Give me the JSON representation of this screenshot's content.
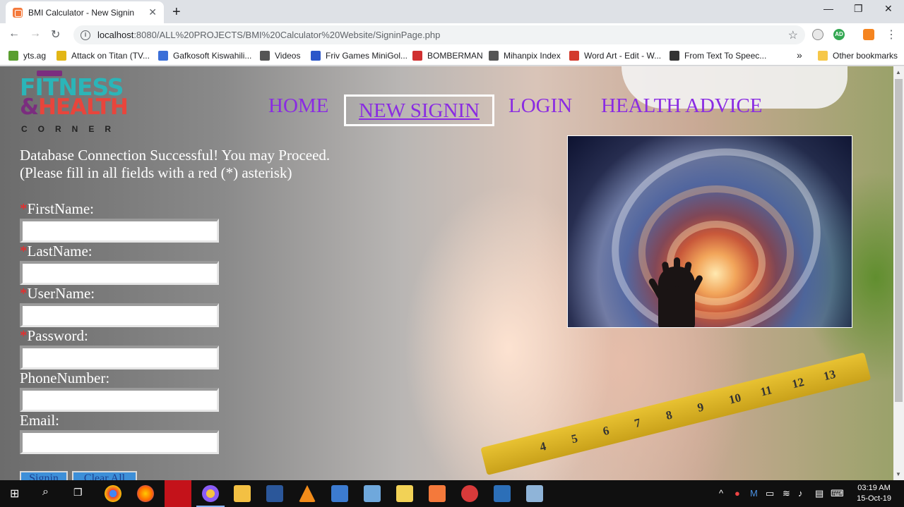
{
  "browser": {
    "tab_title": "BMI Calculator - New Signin",
    "tab_close": "✕",
    "new_tab": "+",
    "minimize": "—",
    "restore": "❐",
    "close": "✕",
    "url_host": "localhost",
    "url_rest": ":8080/ALL%20PROJECTS/BMI%20Calculator%20Website/SigninPage.php",
    "extension_badge": "AD"
  },
  "bookmarks": [
    {
      "label": "yts.ag",
      "icon": "yts-icon",
      "color": "#5a9e2f"
    },
    {
      "label": "Attack on Titan (TV...",
      "icon": "imdb-icon",
      "color": "#e2b616"
    },
    {
      "label": "Gafkosoft Kiswahili...",
      "icon": "globe-icon",
      "color": "#3b6fd8"
    },
    {
      "label": "Videos",
      "icon": "globe-icon",
      "color": "#555555"
    },
    {
      "label": "Friv Games MiniGol...",
      "icon": "friv-icon",
      "color": "#2b56c9"
    },
    {
      "label": "BOMBERMAN",
      "icon": "vs-icon",
      "color": "#d03030"
    },
    {
      "label": "Mihanpix Index",
      "icon": "globe-icon",
      "color": "#555555"
    },
    {
      "label": "Word Art - Edit - W...",
      "icon": "wordart-icon",
      "color": "#d33b2c"
    },
    {
      "label": "From Text To Speec...",
      "icon": "tts-icon",
      "color": "#333333"
    }
  ],
  "bookmarks_more": "»",
  "other_bookmarks": "Other bookmarks",
  "logo": {
    "line1": "FITNESS",
    "line2_amp": "&",
    "line2": "HEALTH",
    "line3": "CORNER"
  },
  "nav": {
    "home": "HOME",
    "new_signin": "NEW SIGNIN",
    "login": "LOGIN",
    "health_advice": "HEALTH ADVICE"
  },
  "messages": {
    "connection": "Database Connection Successful! You may Proceed.",
    "instruction": "(Please fill in all fields with a red (*) asterisk)"
  },
  "form": {
    "required_mark": "*",
    "first_name": "FirstName:",
    "last_name": "LastName:",
    "user_name": "UserName:",
    "password": "Password:",
    "phone": "PhoneNumber:",
    "email": "Email:",
    "signin_button": "Signin",
    "clear_button": "Clear All"
  },
  "tape_numbers": [
    "4",
    "5",
    "6",
    "7",
    "8",
    "9",
    "10",
    "11",
    "12",
    "13"
  ],
  "taskbar": {
    "time": "03:19 AM",
    "date": "15-Oct-19"
  }
}
